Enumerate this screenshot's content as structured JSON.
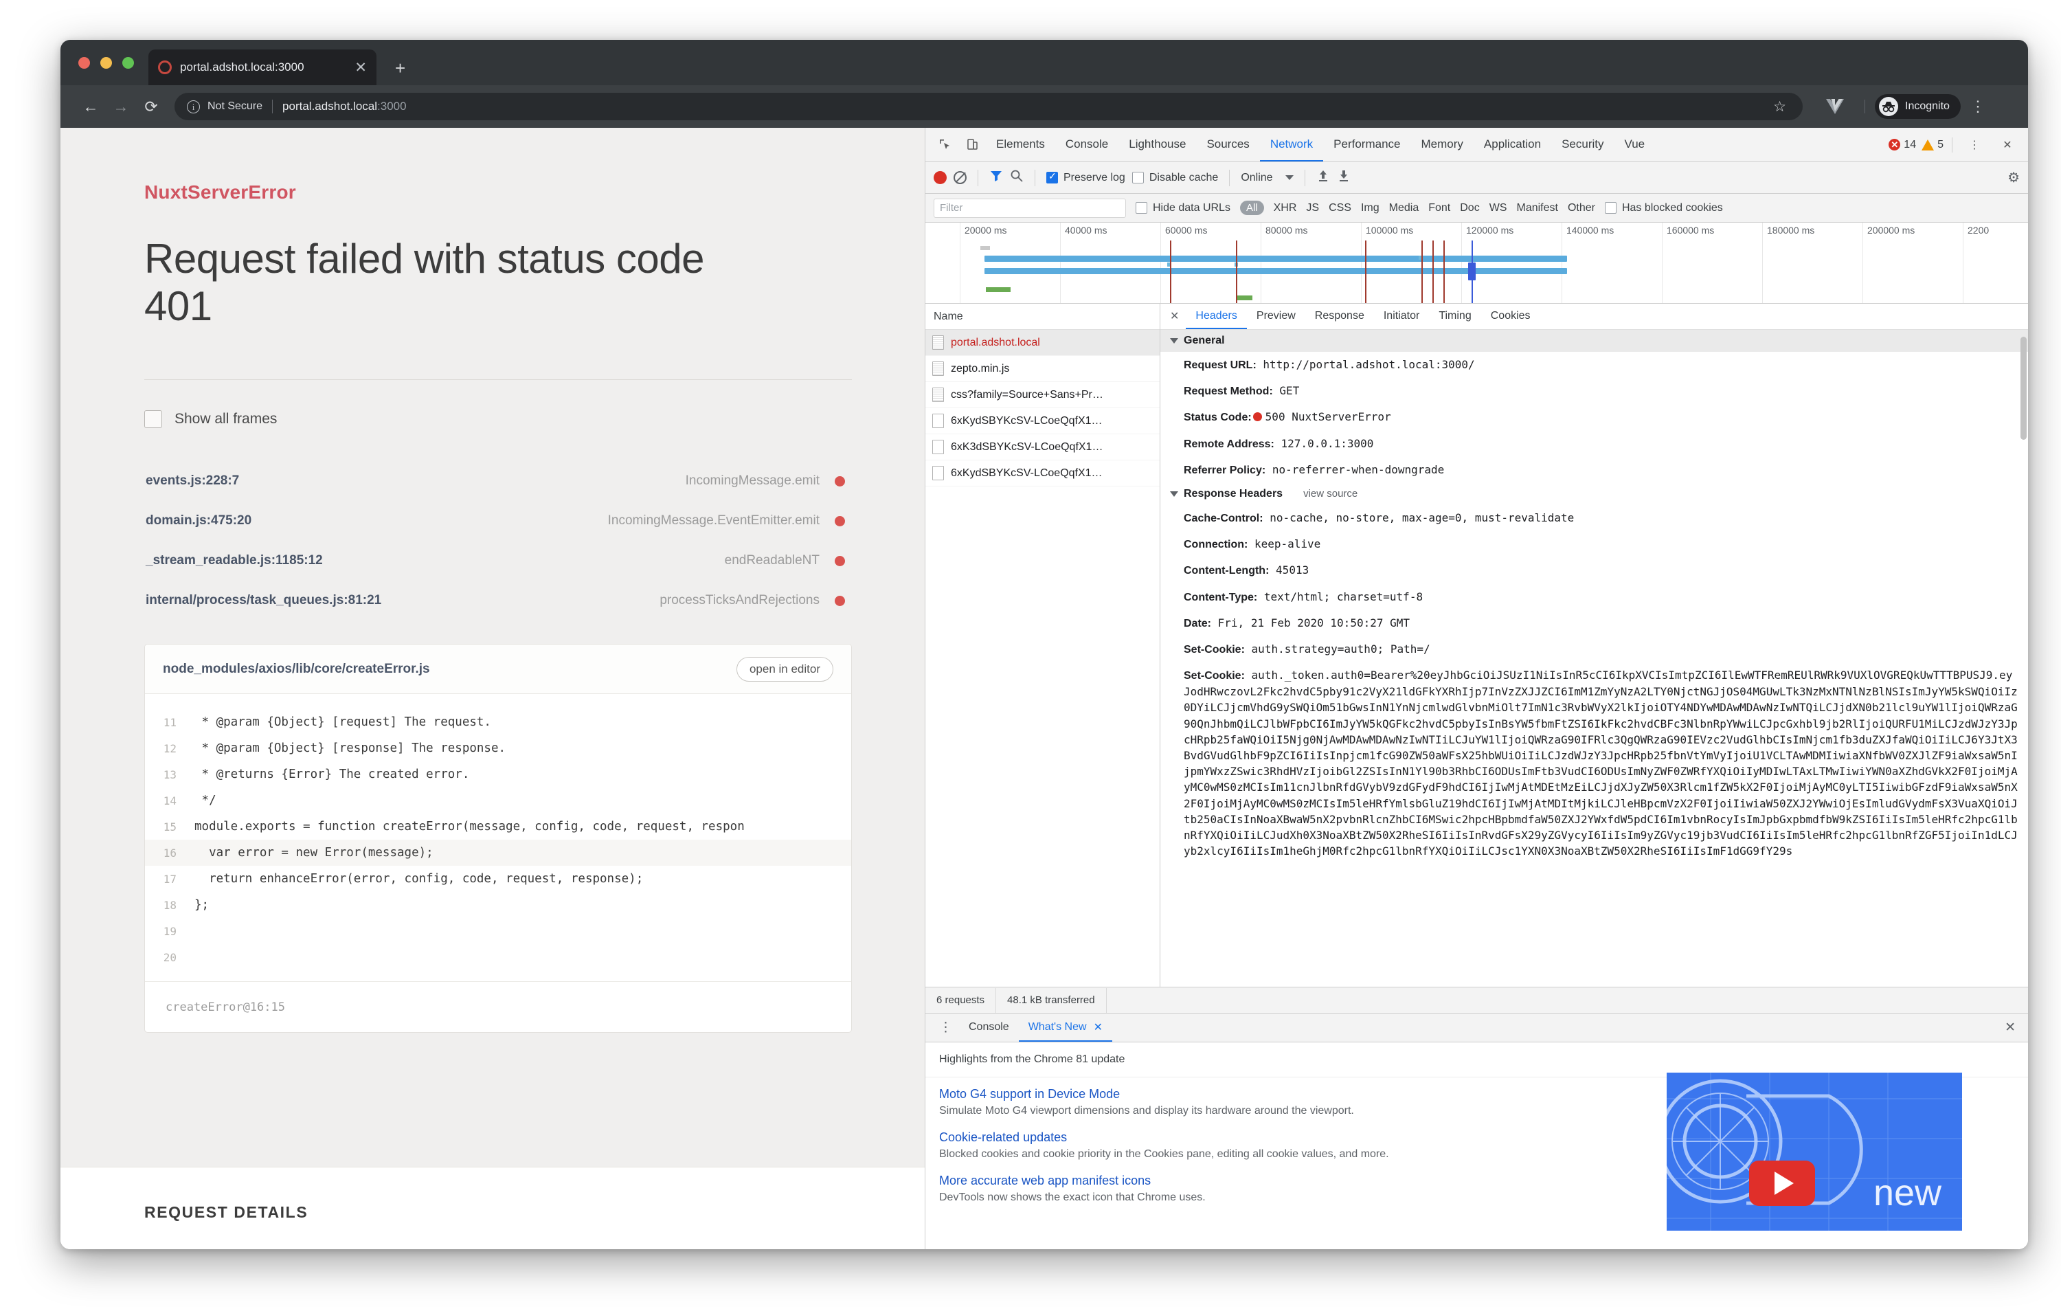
{
  "browser": {
    "tab_title": "portal.adshot.local:3000",
    "tab_close": "✕",
    "new_tab": "+",
    "back": "←",
    "forward": "→",
    "reload": "⟳",
    "security_label": "Not Secure",
    "url_host": "portal.adshot.local",
    "url_port": ":3000",
    "star": "☆",
    "profile_label": "Incognito",
    "menu": "⋮"
  },
  "error_page": {
    "error_name": "NuxtServerError",
    "title": "Request failed with status code 401",
    "show_all_frames": "Show all frames",
    "frames": [
      {
        "file": "events.js:228:7",
        "fn": "IncomingMessage.emit"
      },
      {
        "file": "domain.js:475:20",
        "fn": "IncomingMessage.EventEmitter.emit"
      },
      {
        "file": "_stream_readable.js:1185:12",
        "fn": "endReadableNT"
      },
      {
        "file": "internal/process/task_queues.js:81:21",
        "fn": "processTicksAndRejections"
      }
    ],
    "snippet": {
      "path": "node_modules/axios/lib/core/createError.js",
      "open_in_editor": "open in editor",
      "lines": [
        {
          "no": "11",
          "text": " * @param {Object} [request] The request.",
          "hl": false
        },
        {
          "no": "12",
          "text": " * @param {Object} [response] The response.",
          "hl": false
        },
        {
          "no": "13",
          "text": " * @returns {Error} The created error.",
          "hl": false
        },
        {
          "no": "14",
          "text": " */",
          "hl": false
        },
        {
          "no": "15",
          "text": "module.exports = function createError(message, config, code, request, respon",
          "hl": false
        },
        {
          "no": "16",
          "text": "  var error = new Error(message);",
          "hl": true
        },
        {
          "no": "17",
          "text": "  return enhanceError(error, config, code, request, response);",
          "hl": false
        },
        {
          "no": "18",
          "text": "};",
          "hl": false
        },
        {
          "no": "19",
          "text": "",
          "hl": false
        },
        {
          "no": "20",
          "text": "",
          "hl": false
        }
      ],
      "footer": "createError@16:15"
    },
    "request_details_heading": "REQUEST DETAILS"
  },
  "devtools": {
    "tabs": [
      "Elements",
      "Console",
      "Lighthouse",
      "Sources",
      "Network",
      "Performance",
      "Memory",
      "Application",
      "Security",
      "Vue"
    ],
    "active_tab": "Network",
    "error_count": "14",
    "warning_count": "5",
    "more_menu": "⋮",
    "close": "✕",
    "toolbar": {
      "preserve_log": "Preserve log",
      "disable_cache": "Disable cache",
      "throttle": "Online",
      "gear": "⚙"
    },
    "filterbar": {
      "filter_placeholder": "Filter",
      "hide_data_urls": "Hide data URLs",
      "types": [
        "All",
        "XHR",
        "JS",
        "CSS",
        "Img",
        "Media",
        "Font",
        "Doc",
        "WS",
        "Manifest",
        "Other"
      ],
      "has_blocked_cookies": "Has blocked cookies"
    },
    "overview_ticks": [
      "20000 ms",
      "40000 ms",
      "60000 ms",
      "80000 ms",
      "100000 ms",
      "120000 ms",
      "140000 ms",
      "160000 ms",
      "180000 ms",
      "200000 ms",
      "2200"
    ],
    "requests": {
      "column_name": "Name",
      "rows": [
        {
          "name": "portal.adshot.local",
          "selected": true,
          "icon": "document-icon"
        },
        {
          "name": "zepto.min.js",
          "selected": false,
          "icon": "script-icon"
        },
        {
          "name": "css?family=Source+Sans+Pr…",
          "selected": false,
          "icon": "stylesheet-icon"
        },
        {
          "name": "6xKydSBYKcSV-LCoeQqfX1…",
          "selected": false,
          "icon": "font-icon"
        },
        {
          "name": "6xK3dSBYKcSV-LCoeQqfX1…",
          "selected": false,
          "icon": "font-icon"
        },
        {
          "name": "6xKydSBYKcSV-LCoeQqfX1…",
          "selected": false,
          "icon": "font-icon"
        }
      ]
    },
    "detail_tabs": [
      "Headers",
      "Preview",
      "Response",
      "Initiator",
      "Timing",
      "Cookies"
    ],
    "detail_active_tab": "Headers",
    "general": {
      "section": "General",
      "request_url_label": "Request URL:",
      "request_url": "http://portal.adshot.local:3000/",
      "request_method_label": "Request Method:",
      "request_method": "GET",
      "status_code_label": "Status Code:",
      "status_code": "500 NuxtServerError",
      "remote_address_label": "Remote Address:",
      "remote_address": "127.0.0.1:3000",
      "referrer_policy_label": "Referrer Policy:",
      "referrer_policy": "no-referrer-when-downgrade"
    },
    "response_headers": {
      "section": "Response Headers",
      "view_source": "view source",
      "rows": [
        {
          "label": "Cache-Control:",
          "value": "no-cache, no-store, max-age=0, must-revalidate"
        },
        {
          "label": "Connection:",
          "value": "keep-alive"
        },
        {
          "label": "Content-Length:",
          "value": "45013"
        },
        {
          "label": "Content-Type:",
          "value": "text/html; charset=utf-8"
        },
        {
          "label": "Date:",
          "value": "Fri, 21 Feb 2020 10:50:27 GMT"
        },
        {
          "label": "Set-Cookie:",
          "value": "auth.strategy=auth0; Path=/"
        }
      ],
      "token_label": "Set-Cookie:",
      "token_value": "auth._token.auth0=Bearer%20eyJhbGciOiJSUzI1NiIsInR5cCI6IkpXVCIsImtpZCI6IlEwWTFRemREUlRWRk9VUXlOVGREQkUwTTTBPUSJ9.eyJodHRwczovL2Fkc2hvdC5pby91c2VyX21ldGFkYXRhIjp7InVzZXJJZCI6ImM1ZmYyNzA2LTY0NjctNGJjOS04MGUwLTk3NzMxNTNlNzBlNSIsImJyYW5kSWQiOiIz0DYiLCJjcmVhdG9ySWQiOm51bGwsInN1YnNjcmlwdGlvbnMiOlt7ImN1c3RvbWVyX2lkIjoiOTY4NDYwMDAwMDAwNzIwNTQiLCJjdXN0b21lcl9uYW1lIjoiQWRzaG90QnJhbmQiLCJlbWFpbCI6ImJyYW5kQGFkc2hvdC5pbyIsInBsYW5fbmFtZSI6IkFkc2hvdCBFc3NlbnRpYWwiLCJpcGxhbl9jb2RlIjoiQURFU1MiLCJzdWJzY3JpcHRpb25faWQiOiI5Njg0NjAwMDAwMDAwNzIwNTIiLCJuYW1lIjoiQWRzaG90IFRlc3QgQWRzaG90IEVzc2VudGlhbCIsImNjcm1fb3duZXJfaWQiOiIiLCJ6Y3JtX3BvdGVudGlhbF9pZCI6IiIsInpjcm1fcG90ZW50aWFsX25hbWUiOiIiLCJzdWJzY3JpcHRpb25fbnVtYmVyIjoiU1VCLTAwMDMIiwiaXNfbWV0ZXJlZF9iaWxsaW5nIjpmYWxzZSwic3RhdHVzIjoibGl2ZSIsInN1Yl90b3RhbCI6ODUsImFtb3VudCI6ODUsImNyZWF0ZWRfYXQiOiIyMDIwLTAxLTMwIiwiYWN0aXZhdGVkX2F0IjoiMjAyMC0wMS0zMCIsIm11cnJlbnRfdGVybV9zdGFydF9hdCI6IjIwMjAtMDEtMzEiLCJjdXJyZW50X3Rlcm1fZW5kX2F0IjoiMjAyMC0yLTI5IiwibGFzdF9iaWxsaW5nX2F0IjoiMjAyMC0wMS0zMCIsIm5leHRfYmlsbGluZ19hdCI6IjIwMjAtMDItMjkiLCJleHBpcmVzX2F0IjoiIiwiaW50ZXJ2YWwiOjEsImludGVydmFsX3VuaXQiOiJtb250aCIsInNoaXBwaW5nX2pvbnRlcnZhbCI6MSwic2hpcHBpbmdfaW50ZXJ2YWxfdW5pdCI6Im1vbnRocyIsImJpbGxpbmdfbW9kZSI6IiIsIm5leHRfc2hpcG1lbnRfYXQiOiIiLCJudXh0X3NoaXBtZW50X2RheSI6IiIsInRvdGFsX29yZGVycyI6IiIsIm9yZGVyc19jb3VudCI6IiIsIm5leHRfc2hpcG1lbnRfZGF5IjoiIn1dLCJyb2xlcyI6IiIsIm1heGhjM0Rfc2hpcG1lbnRfYXQiOiIiLCJsc1YXN0X3NoaXBtZW50X2RheSI6IiIsImF1dGG9fY29s"
    },
    "status_bar": {
      "requests": "6 requests",
      "transferred": "48.1 kB transferred"
    },
    "drawer": {
      "kebab": "⋮",
      "tabs": [
        "Console",
        "What's New"
      ],
      "active_tab": "What's New",
      "tab_close": "✕",
      "close": "✕",
      "subtitle": "Highlights from the Chrome 81 update",
      "items": [
        {
          "title": "Moto G4 support in Device Mode",
          "desc": "Simulate Moto G4 viewport dimensions and display its hardware around the viewport."
        },
        {
          "title": "Cookie-related updates",
          "desc": "Blocked cookies and cookie priority in the Cookies pane, editing all cookie values, and more."
        },
        {
          "title": "More accurate web app manifest icons",
          "desc": "DevTools now shows the exact icon that Chrome uses."
        }
      ],
      "thumb_text": "new"
    }
  }
}
